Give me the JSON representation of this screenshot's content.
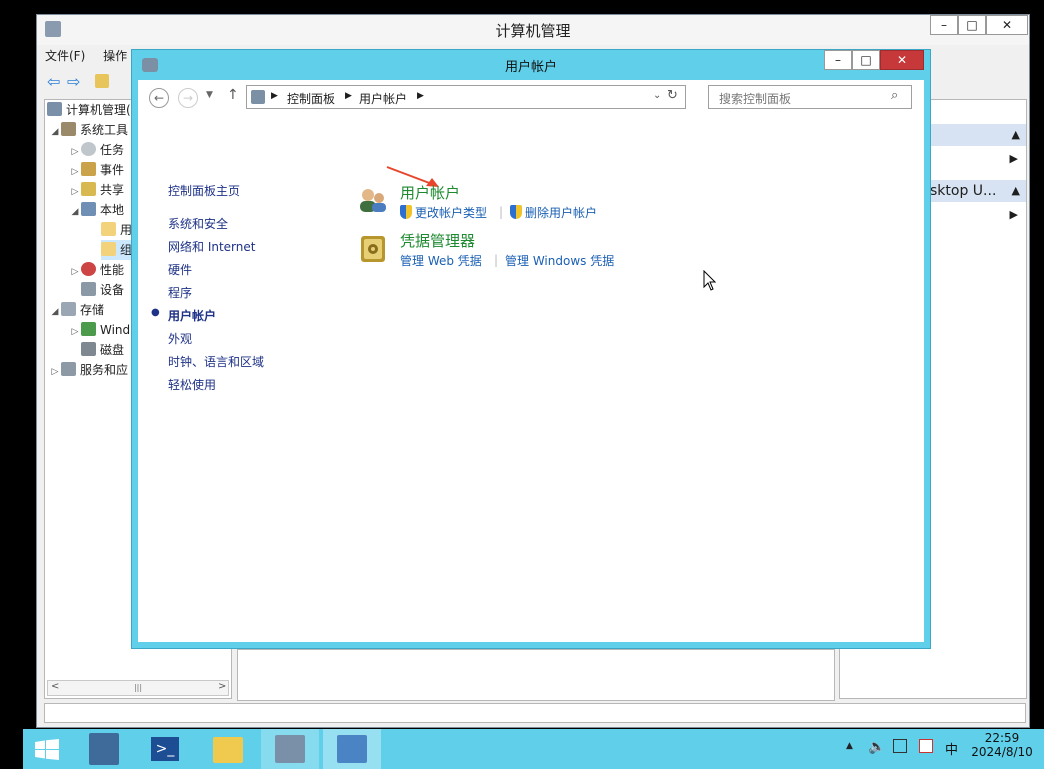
{
  "back_window": {
    "title": "计算机管理",
    "menu": [
      "文件(F)",
      "操作"
    ],
    "tree": [
      {
        "label": "计算机管理(",
        "indent": 0,
        "expander": ""
      },
      {
        "label": "系统工具",
        "indent": 1,
        "expander": "◢"
      },
      {
        "label": "任务",
        "indent": 2,
        "expander": "▷"
      },
      {
        "label": "事件",
        "indent": 2,
        "expander": "▷"
      },
      {
        "label": "共享",
        "indent": 2,
        "expander": "▷"
      },
      {
        "label": "本地",
        "indent": 2,
        "expander": "◢"
      },
      {
        "label": "用",
        "indent": 3,
        "expander": ""
      },
      {
        "label": "组",
        "indent": 3,
        "expander": ""
      },
      {
        "label": "性能",
        "indent": 2,
        "expander": "▷"
      },
      {
        "label": "设备",
        "indent": 2,
        "expander": ""
      },
      {
        "label": "存储",
        "indent": 1,
        "expander": "◢"
      },
      {
        "label": "Wind",
        "indent": 2,
        "expander": "▷"
      },
      {
        "label": "磁盘",
        "indent": 2,
        "expander": ""
      },
      {
        "label": "服务和应",
        "indent": 1,
        "expander": "▷"
      }
    ],
    "actions_partial": "sktop U..."
  },
  "window": {
    "title": "用户帐户",
    "breadcrumb": [
      "控制面板",
      "用户帐户"
    ],
    "search_placeholder": "搜索控制面板",
    "left_nav": [
      {
        "label": "控制面板主页",
        "active": false
      },
      {
        "label": "系统和安全",
        "active": false
      },
      {
        "label": "网络和 Internet",
        "active": false
      },
      {
        "label": "硬件",
        "active": false
      },
      {
        "label": "程序",
        "active": false
      },
      {
        "label": "用户帐户",
        "active": true
      },
      {
        "label": "外观",
        "active": false
      },
      {
        "label": "时钟、语言和区域",
        "active": false
      },
      {
        "label": "轻松使用",
        "active": false
      }
    ],
    "categories": [
      {
        "title": "用户帐户",
        "links": [
          "更改帐户类型",
          "删除用户帐户"
        ]
      },
      {
        "title": "凭据管理器",
        "links": [
          "管理 Web 凭据",
          "管理 Windows 凭据"
        ]
      }
    ]
  },
  "taskbar": {
    "time": "22:59",
    "date": "2024/8/10",
    "ime": "中"
  },
  "colors": {
    "accent": "#5fcfea",
    "close": "#c7383a",
    "link": "#1a5fb4",
    "heading": "#1d8a2f"
  }
}
